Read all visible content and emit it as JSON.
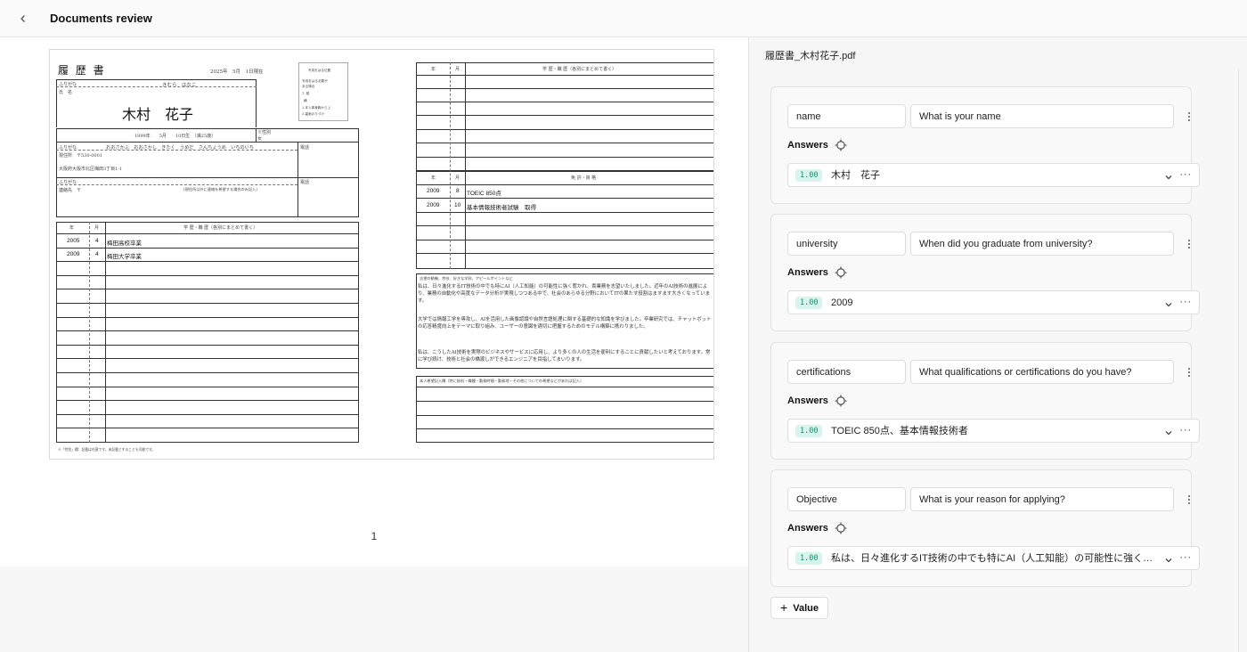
{
  "header": {
    "title": "Documents review"
  },
  "viewer": {
    "page_number": "1",
    "resume": {
      "title": "履 歴 書",
      "date_line": "2025年　5月　1日現在",
      "photo_note": [
        "写真をはる位置",
        "写真をはる必要が",
        "ある場合",
        "1. 縦",
        "横",
        "2.本人単身胸から上",
        "3.裏面のりづけ"
      ],
      "furigana_label": "ふりがな",
      "furigana_value": "きむら　はなこ",
      "name_label": "氏　名",
      "name": "木村　花子",
      "birth_line": "1999年　　5月　　10日生　（満25歳）",
      "gender_label": "※性別",
      "gender_value": "女",
      "address_furigana": "おおさかふ　おおさかし　きたく　うめだ　さんちょうめ　いちのいち",
      "address_line1": "現住所　〒530-0001",
      "address_line2": "大阪府大阪市北区梅田3丁目1-1",
      "phone_label": "電話",
      "contact_label": "連絡先　〒",
      "contact_note": "(現住所以外に連絡を希望する場合のみ記入)",
      "history_header": {
        "year": "年",
        "month": "月",
        "title": "学 歴・職 歴（各別にまとめて書く）"
      },
      "education": [
        {
          "year": "2005",
          "month": "4",
          "text": "梅田高校卒業"
        },
        {
          "year": "2009",
          "month": "4",
          "text": "梅田大学卒業"
        }
      ],
      "footnote": "※「性別」欄：記載は任意です。未記載とすることも可能です。",
      "license_header": {
        "year": "年",
        "month": "月",
        "title": "免 許・資 格"
      },
      "licenses": [
        {
          "year": "2009",
          "month": "8",
          "text": "TOEIC 850点"
        },
        {
          "year": "2009",
          "month": "10",
          "text": "基本情報技術者試験　取得"
        }
      ],
      "motivation_label": "志望の動機、特技、好きな学科、アピールポイントなど",
      "motivation_paragraphs": [
        "私は、日々進化するIT技術の中でも特にAI（人工知能）の可能性に強く惹かれ、貴業務を志望いたしました。近年のAI技術の進展により、業務の自動化や高度なデータ分析が実現しつつある中で、社会のあらゆる分野においてITの果たす役割はますます大きくなっています。",
        "大学では情報工学を専攻し、AIを活用した画像認識や自然言語処理に関する基礎的な知識を学びました。卒業研究では、チャットボットの応答精度向上をテーマに取り組み、ユーザーの意図を適切に把握するためのモデル構築に携わりました。",
        "私は、こうしたAI技術を実際のビジネスやサービスに応用し、より多くの人の生活を便利にすることに貢献したいと考えております。常に学び続け、技術と社会の橋渡しができるエンジニアを目指してまいります。"
      ],
      "request_label": "本人希望記入欄（特に給料・職種・勤務時間・勤務地・その他についての希望などがあれば記入）"
    }
  },
  "panel": {
    "filename": "履歴書_木村花子.pdf",
    "answers_label": "Answers",
    "fields": [
      {
        "key": "name",
        "question": "What is your name",
        "score": "1.00",
        "answer": "木村　花子"
      },
      {
        "key": "university",
        "question": "When did you graduate from university?",
        "score": "1.00",
        "answer": "2009"
      },
      {
        "key": "certifications",
        "question": "What qualifications or certifications do you have?",
        "score": "1.00",
        "answer": "TOEIC 850点、基本情報技術者"
      },
      {
        "key": "Objective",
        "question": "What is your reason for applying?",
        "score": "1.00",
        "answer": "私は、日々進化するIT技術の中でも特にAI（人工知能）の可能性に強く惹かれ、貴業務を志望いたしました。"
      }
    ],
    "add_value_label": "Value"
  }
}
